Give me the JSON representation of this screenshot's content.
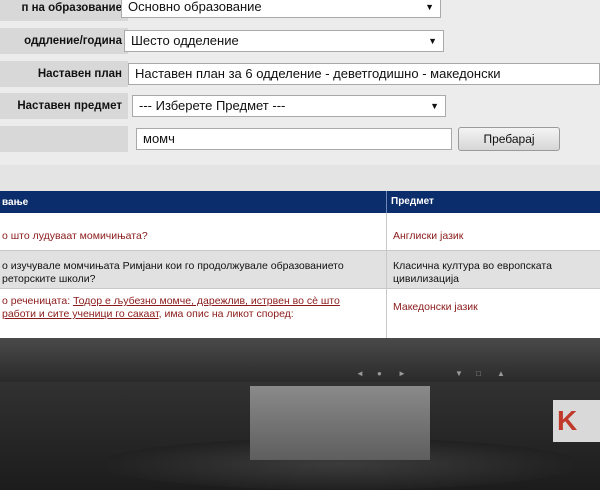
{
  "form": {
    "rows": [
      {
        "label": "п на образование",
        "value": "Основно образование",
        "dropdown": true
      },
      {
        "label": "оддление/година",
        "value": "Шесто одделение",
        "dropdown": true
      },
      {
        "label": "Наставен план",
        "value": "Наставен план за 6 одделение - деветгодишно - македонски",
        "dropdown": false
      },
      {
        "label": "Наставен предмет",
        "value": "--- Изберете Предмет ---",
        "dropdown": true
      }
    ],
    "search_value": "момч",
    "search_button": "Пребарај"
  },
  "table": {
    "headers": [
      "вање",
      "Предмет"
    ],
    "rows": [
      {
        "question": "о што лудуваат момичињата?",
        "subject": "Англиски јазик"
      },
      {
        "question_lines": [
          "о изучувале момчињата Римјани кои го продолжувале образованието",
          "реторските школи?"
        ],
        "subject_lines": [
          "Класична култура во европската",
          "цивилизација"
        ]
      },
      {
        "prefix": "о реченицата: ",
        "link_text": "Тодор е љубезно момче, дарежлив, истрвен во сè што",
        "link_text2": "работи и сите ученици го сакаат",
        "suffix": ", има опис на ликот според:",
        "subject": "Македонски јазик"
      }
    ]
  },
  "monitor": {
    "controls": [
      "◄",
      "●",
      "►",
      "▼",
      "□",
      "▲"
    ],
    "brand_fragment": "K"
  },
  "colors": {
    "table_header": "#0b2d6b",
    "link": "#8b1a1a"
  }
}
